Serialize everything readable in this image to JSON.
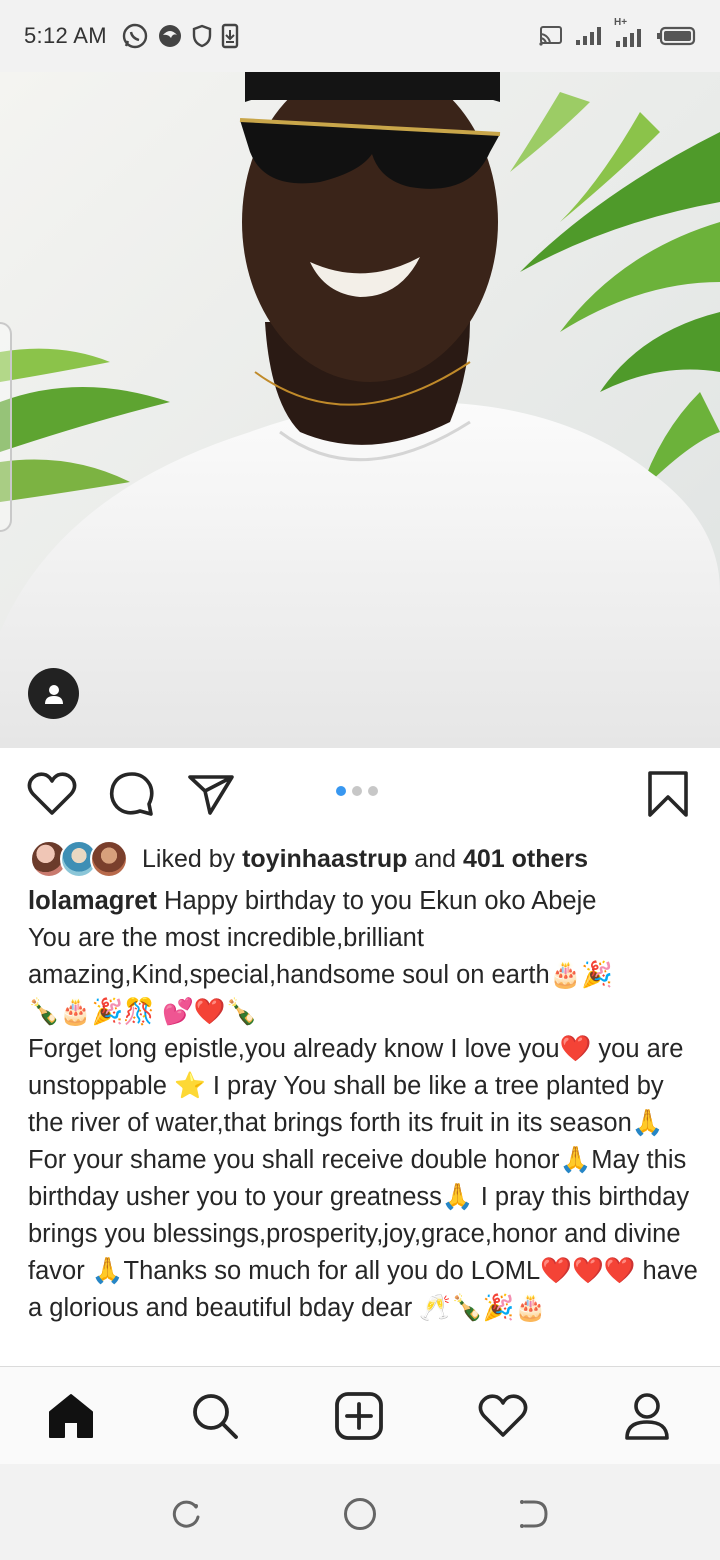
{
  "status_bar": {
    "time": "5:12 AM",
    "left_icons": [
      "whatsapp-icon",
      "browser-icon",
      "shield-icon",
      "download-icon"
    ],
    "right_icons": [
      "cast-icon",
      "signal-icon",
      "signal-h-plus-icon",
      "battery-icon"
    ],
    "network_label": "H+"
  },
  "post": {
    "photo_icon": "person-tag-icon",
    "carousel": {
      "count": 3,
      "active_index": 0
    },
    "likes": {
      "prefix": "Liked by ",
      "user": "toyinhaastrup",
      "middle": " and ",
      "others": "401 others"
    },
    "caption": {
      "username": "lolamagret",
      "text": " Happy birthday to you Ekun oko Abeje\nYou are the most incredible,brilliant amazing,Kind,special,handsome soul on earth🎂🎉\n🍾🎂🎉🎊 💕❤️🍾\nForget long epistle,you already know I love you❤️ you are unstoppable ⭐ I pray You shall be like a tree planted by the river of water,that brings forth its fruit in its season🙏For your shame you shall receive double honor🙏May this  birthday usher you to your greatness🙏 I pray this birthday brings you blessings,prosperity,joy,grace,honor and divine favor 🙏Thanks so much for all you do LOML❤️❤️❤️ have a glorious and beautiful bday dear 🥂🍾🎉🎂"
    },
    "colors": {
      "active_dot": "#3897f0",
      "text": "#262626"
    }
  },
  "bottom_nav": {
    "items": [
      "home-icon",
      "search-icon",
      "new-post-icon",
      "activity-icon",
      "profile-icon"
    ]
  },
  "system_nav": {
    "items": [
      "recents-icon",
      "home-circle-icon",
      "back-icon"
    ]
  }
}
